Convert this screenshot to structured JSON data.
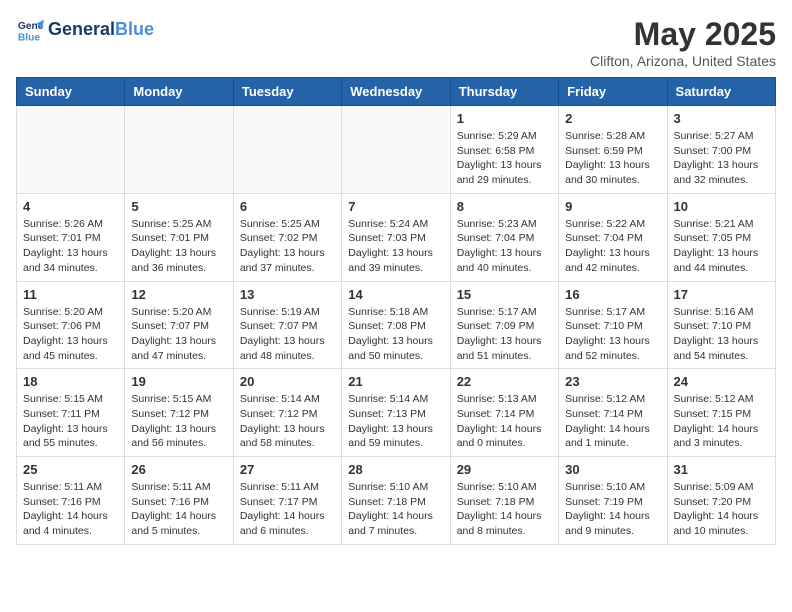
{
  "logo": {
    "line1": "General",
    "line2": "Blue"
  },
  "title": "May 2025",
  "location": "Clifton, Arizona, United States",
  "weekdays": [
    "Sunday",
    "Monday",
    "Tuesday",
    "Wednesday",
    "Thursday",
    "Friday",
    "Saturday"
  ],
  "weeks": [
    [
      {
        "day": "",
        "info": ""
      },
      {
        "day": "",
        "info": ""
      },
      {
        "day": "",
        "info": ""
      },
      {
        "day": "",
        "info": ""
      },
      {
        "day": "1",
        "info": "Sunrise: 5:29 AM\nSunset: 6:58 PM\nDaylight: 13 hours\nand 29 minutes."
      },
      {
        "day": "2",
        "info": "Sunrise: 5:28 AM\nSunset: 6:59 PM\nDaylight: 13 hours\nand 30 minutes."
      },
      {
        "day": "3",
        "info": "Sunrise: 5:27 AM\nSunset: 7:00 PM\nDaylight: 13 hours\nand 32 minutes."
      }
    ],
    [
      {
        "day": "4",
        "info": "Sunrise: 5:26 AM\nSunset: 7:01 PM\nDaylight: 13 hours\nand 34 minutes."
      },
      {
        "day": "5",
        "info": "Sunrise: 5:25 AM\nSunset: 7:01 PM\nDaylight: 13 hours\nand 36 minutes."
      },
      {
        "day": "6",
        "info": "Sunrise: 5:25 AM\nSunset: 7:02 PM\nDaylight: 13 hours\nand 37 minutes."
      },
      {
        "day": "7",
        "info": "Sunrise: 5:24 AM\nSunset: 7:03 PM\nDaylight: 13 hours\nand 39 minutes."
      },
      {
        "day": "8",
        "info": "Sunrise: 5:23 AM\nSunset: 7:04 PM\nDaylight: 13 hours\nand 40 minutes."
      },
      {
        "day": "9",
        "info": "Sunrise: 5:22 AM\nSunset: 7:04 PM\nDaylight: 13 hours\nand 42 minutes."
      },
      {
        "day": "10",
        "info": "Sunrise: 5:21 AM\nSunset: 7:05 PM\nDaylight: 13 hours\nand 44 minutes."
      }
    ],
    [
      {
        "day": "11",
        "info": "Sunrise: 5:20 AM\nSunset: 7:06 PM\nDaylight: 13 hours\nand 45 minutes."
      },
      {
        "day": "12",
        "info": "Sunrise: 5:20 AM\nSunset: 7:07 PM\nDaylight: 13 hours\nand 47 minutes."
      },
      {
        "day": "13",
        "info": "Sunrise: 5:19 AM\nSunset: 7:07 PM\nDaylight: 13 hours\nand 48 minutes."
      },
      {
        "day": "14",
        "info": "Sunrise: 5:18 AM\nSunset: 7:08 PM\nDaylight: 13 hours\nand 50 minutes."
      },
      {
        "day": "15",
        "info": "Sunrise: 5:17 AM\nSunset: 7:09 PM\nDaylight: 13 hours\nand 51 minutes."
      },
      {
        "day": "16",
        "info": "Sunrise: 5:17 AM\nSunset: 7:10 PM\nDaylight: 13 hours\nand 52 minutes."
      },
      {
        "day": "17",
        "info": "Sunrise: 5:16 AM\nSunset: 7:10 PM\nDaylight: 13 hours\nand 54 minutes."
      }
    ],
    [
      {
        "day": "18",
        "info": "Sunrise: 5:15 AM\nSunset: 7:11 PM\nDaylight: 13 hours\nand 55 minutes."
      },
      {
        "day": "19",
        "info": "Sunrise: 5:15 AM\nSunset: 7:12 PM\nDaylight: 13 hours\nand 56 minutes."
      },
      {
        "day": "20",
        "info": "Sunrise: 5:14 AM\nSunset: 7:12 PM\nDaylight: 13 hours\nand 58 minutes."
      },
      {
        "day": "21",
        "info": "Sunrise: 5:14 AM\nSunset: 7:13 PM\nDaylight: 13 hours\nand 59 minutes."
      },
      {
        "day": "22",
        "info": "Sunrise: 5:13 AM\nSunset: 7:14 PM\nDaylight: 14 hours\nand 0 minutes."
      },
      {
        "day": "23",
        "info": "Sunrise: 5:12 AM\nSunset: 7:14 PM\nDaylight: 14 hours\nand 1 minute."
      },
      {
        "day": "24",
        "info": "Sunrise: 5:12 AM\nSunset: 7:15 PM\nDaylight: 14 hours\nand 3 minutes."
      }
    ],
    [
      {
        "day": "25",
        "info": "Sunrise: 5:11 AM\nSunset: 7:16 PM\nDaylight: 14 hours\nand 4 minutes."
      },
      {
        "day": "26",
        "info": "Sunrise: 5:11 AM\nSunset: 7:16 PM\nDaylight: 14 hours\nand 5 minutes."
      },
      {
        "day": "27",
        "info": "Sunrise: 5:11 AM\nSunset: 7:17 PM\nDaylight: 14 hours\nand 6 minutes."
      },
      {
        "day": "28",
        "info": "Sunrise: 5:10 AM\nSunset: 7:18 PM\nDaylight: 14 hours\nand 7 minutes."
      },
      {
        "day": "29",
        "info": "Sunrise: 5:10 AM\nSunset: 7:18 PM\nDaylight: 14 hours\nand 8 minutes."
      },
      {
        "day": "30",
        "info": "Sunrise: 5:10 AM\nSunset: 7:19 PM\nDaylight: 14 hours\nand 9 minutes."
      },
      {
        "day": "31",
        "info": "Sunrise: 5:09 AM\nSunset: 7:20 PM\nDaylight: 14 hours\nand 10 minutes."
      }
    ]
  ]
}
